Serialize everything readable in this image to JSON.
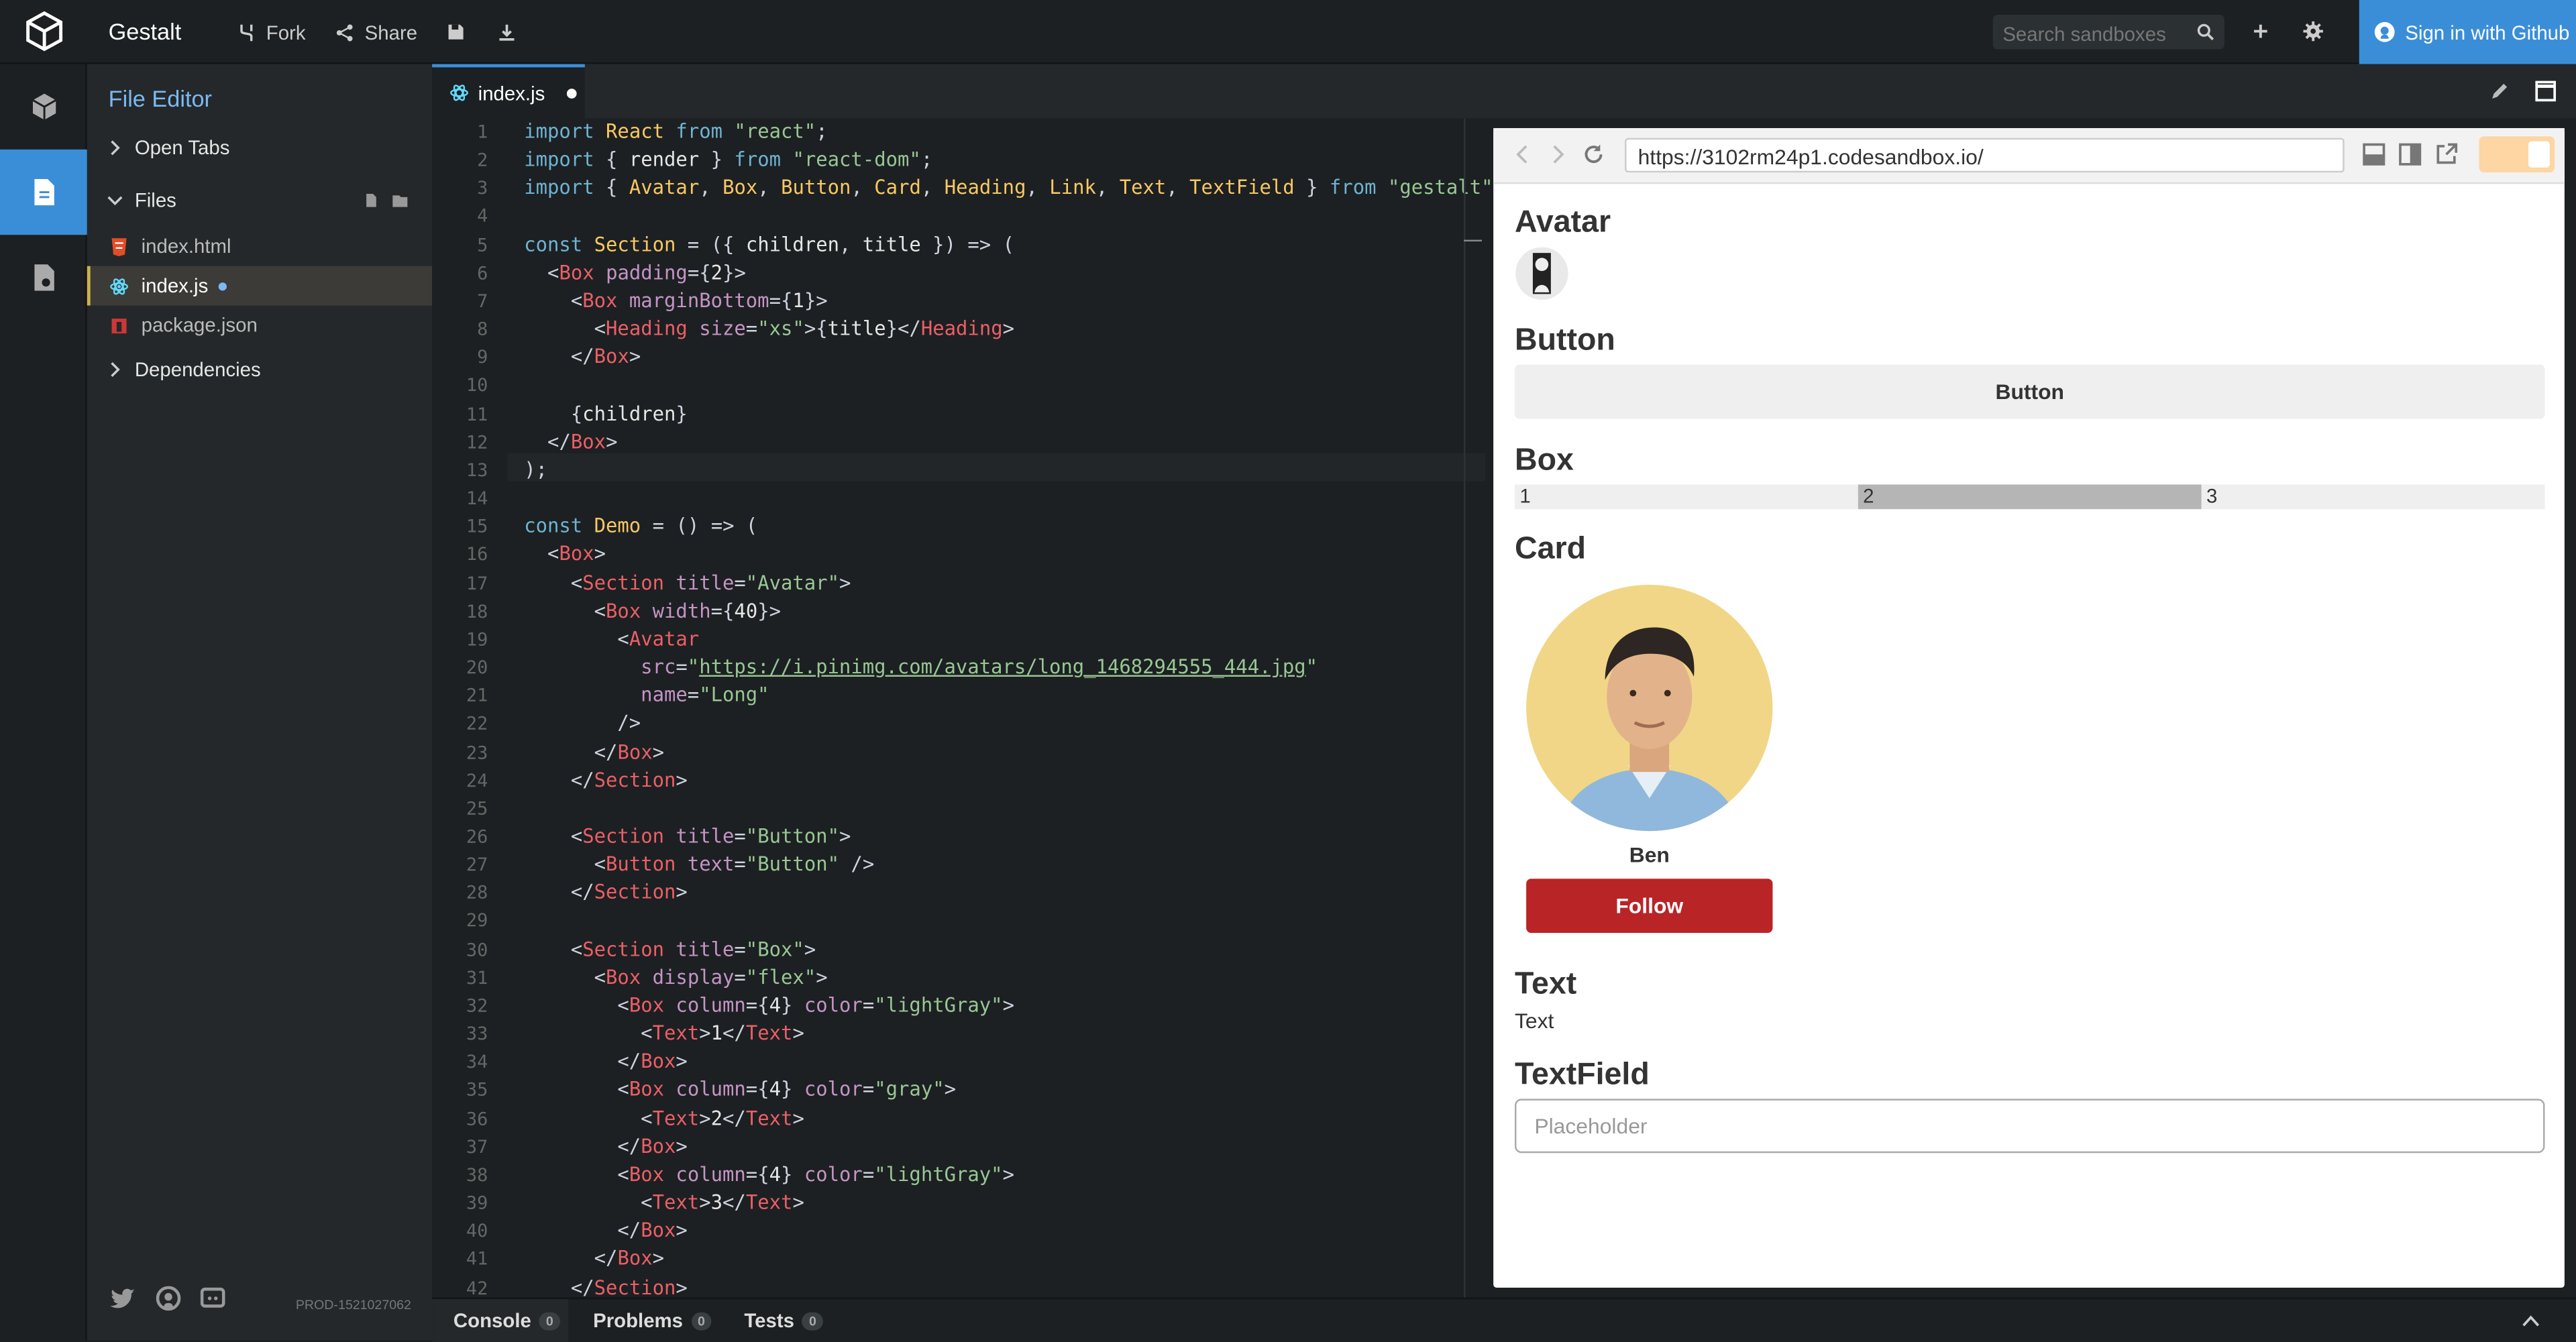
{
  "header": {
    "app_title": "Gestalt",
    "fork_label": "Fork",
    "share_label": "Share",
    "search_placeholder": "Search sandboxes",
    "signin_label": "Sign in with Github"
  },
  "sidebar": {
    "title": "File Editor",
    "open_tabs_label": "Open Tabs",
    "files_label": "Files",
    "files": [
      {
        "name": "index.html",
        "icon": "html-file-icon"
      },
      {
        "name": "index.js",
        "icon": "react-file-icon",
        "active": true,
        "modified": true
      },
      {
        "name": "package.json",
        "icon": "npm-file-icon"
      }
    ],
    "dependencies_label": "Dependencies",
    "build_id": "PROD-1521027062"
  },
  "editor": {
    "tab_label": "index.js",
    "line_numbers": [
      "1",
      "2",
      "3",
      "4",
      "5",
      "6",
      "7",
      "8",
      "9",
      "10",
      "11",
      "12",
      "13",
      "14",
      "15",
      "16",
      "17",
      "18",
      "19",
      "20",
      "21",
      "22",
      "23",
      "24",
      "25",
      "26",
      "27",
      "28",
      "29",
      "30",
      "31",
      "32",
      "33",
      "34",
      "35",
      "36",
      "37",
      "38",
      "39",
      "40",
      "41",
      "42"
    ],
    "lines": [
      "import React from \"react\";",
      "import { render } from \"react-dom\";",
      "import { Avatar, Box, Button, Card, Heading, Link, Text, TextField } from \"gestalt\";",
      "",
      "const Section = ({ children, title }) => (",
      "  <Box padding={2}>",
      "    <Box marginBottom={1}>",
      "      <Heading size=\"xs\">{title}</Heading>",
      "    </Box>",
      "",
      "    {children}",
      "  </Box>",
      ");",
      "",
      "const Demo = () => (",
      "  <Box>",
      "    <Section title=\"Avatar\">",
      "      <Box width={40}>",
      "        <Avatar",
      "          src=\"https://i.pinimg.com/avatars/long_1468294555_444.jpg\"",
      "          name=\"Long\"",
      "        />",
      "      </Box>",
      "    </Section>",
      "",
      "    <Section title=\"Button\">",
      "      <Button text=\"Button\" />",
      "    </Section>",
      "",
      "    <Section title=\"Box\">",
      "      <Box display=\"flex\">",
      "        <Box column={4} color=\"lightGray\">",
      "          <Text>1</Text>",
      "        </Box>",
      "        <Box column={4} color=\"gray\">",
      "          <Text>2</Text>",
      "        </Box>",
      "        <Box column={4} color=\"lightGray\">",
      "          <Text>3</Text>",
      "        </Box>",
      "      </Box>",
      "    </Section>"
    ]
  },
  "preview": {
    "url": "https://3102rm24p1.codesandbox.io/",
    "avatar_heading": "Avatar",
    "button_heading": "Button",
    "button_label": "Button",
    "box_heading": "Box",
    "box_cells": [
      {
        "text": "1",
        "color": "#efefef"
      },
      {
        "text": "2",
        "color": "#b5b5b5"
      },
      {
        "text": "3",
        "color": "#efefef"
      }
    ],
    "card_heading": "Card",
    "card_name": "Ben",
    "follow_label": "Follow",
    "text_heading": "Text",
    "text_value": "Text",
    "textfield_heading": "TextField",
    "textfield_placeholder": "Placeholder"
  },
  "bottom": {
    "tabs": [
      {
        "label": "Console",
        "count": "0"
      },
      {
        "label": "Problems",
        "count": "0"
      },
      {
        "label": "Tests",
        "count": "0"
      }
    ]
  },
  "colors": {
    "accent": "#3a8ed8",
    "follow": "#b92427",
    "link": "#7cb9f2"
  }
}
